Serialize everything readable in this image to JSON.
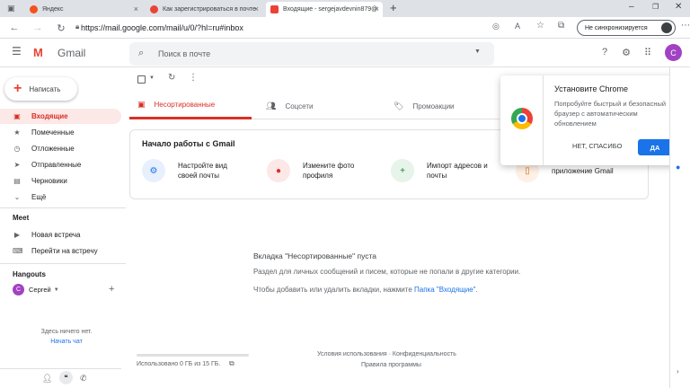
{
  "browser": {
    "tabs": [
      {
        "label": "Яндекс",
        "fav_color": "#f4511e"
      },
      {
        "label": "Как зарегистрироваться в почте",
        "fav_color": "#ea4335"
      },
      {
        "label": "Входящие - sergejavdevnin879@",
        "fav_color": "#ea4335",
        "active": true
      }
    ],
    "new_tab": "+",
    "url": "https://mail.google.com/mail/u/0/?hl=ru#inbox",
    "sync_label": "Не синхронизируется"
  },
  "gmail": {
    "logo_text": "Gmail",
    "search_placeholder": "Поиск в почте",
    "avatar_letter": "С",
    "compose_label": "Написать",
    "nav": [
      {
        "label": "Входящие",
        "icon": "inbox-icon",
        "active": true
      },
      {
        "label": "Помеченные",
        "icon": "star-icon"
      },
      {
        "label": "Отложенные",
        "icon": "clock-icon"
      },
      {
        "label": "Отправленные",
        "icon": "send-icon"
      },
      {
        "label": "Черновики",
        "icon": "draft-icon"
      },
      {
        "label": "Ещё",
        "icon": "chevron-down-icon"
      }
    ],
    "meet": {
      "title": "Meet",
      "items": [
        {
          "label": "Новая встреча",
          "icon": "video-icon"
        },
        {
          "label": "Перейти на встречу",
          "icon": "keyboard-icon"
        }
      ]
    },
    "hangouts": {
      "title": "Hangouts",
      "user": "Сергей",
      "empty": "Здесь ничего нет.",
      "start_chat": "Начать чат"
    },
    "categories": [
      {
        "label": "Несортированные",
        "active": true
      },
      {
        "label": "Соцсети"
      },
      {
        "label": "Промоакции"
      }
    ],
    "starter": {
      "title": "Начало работы с Gmail",
      "steps": [
        {
          "text": "Настройте вид своей почты",
          "color": "#e8f0fe",
          "icon_color": "#1a73e8"
        },
        {
          "text": "Измените фото профиля",
          "color": "#fce8e6",
          "icon_color": "#d93025"
        },
        {
          "text": "Импорт адресов и почты",
          "color": "#e6f4ea",
          "icon_color": "#188038"
        },
        {
          "text": "приложение Gmail",
          "color": "#fef0e6",
          "icon_color": "#e8710a"
        }
      ]
    },
    "empty_state": {
      "title": "Вкладка \"Несортированные\" пуста",
      "line1": "Раздел для личных сообщений и писем, которые не попали в другие категории.",
      "line2_prefix": "Чтобы добавить или удалить вкладки, нажмите",
      "line2_link": "Папка \"Входящие\"",
      "line2_suffix": "."
    },
    "footer": {
      "storage": "Использовано 0 ГБ из 15 ГБ.",
      "storage_fraction": 0,
      "terms": "Условия использования · Конфиденциальность",
      "policy": "Правила программы"
    }
  },
  "chrome_popup": {
    "title": "Установите Chrome",
    "body": "Попробуйте быстрый и безопасный браузер с автоматическим обновлением",
    "no_label": "НЕТ, СПАСИБО",
    "yes_label": "ДА"
  }
}
